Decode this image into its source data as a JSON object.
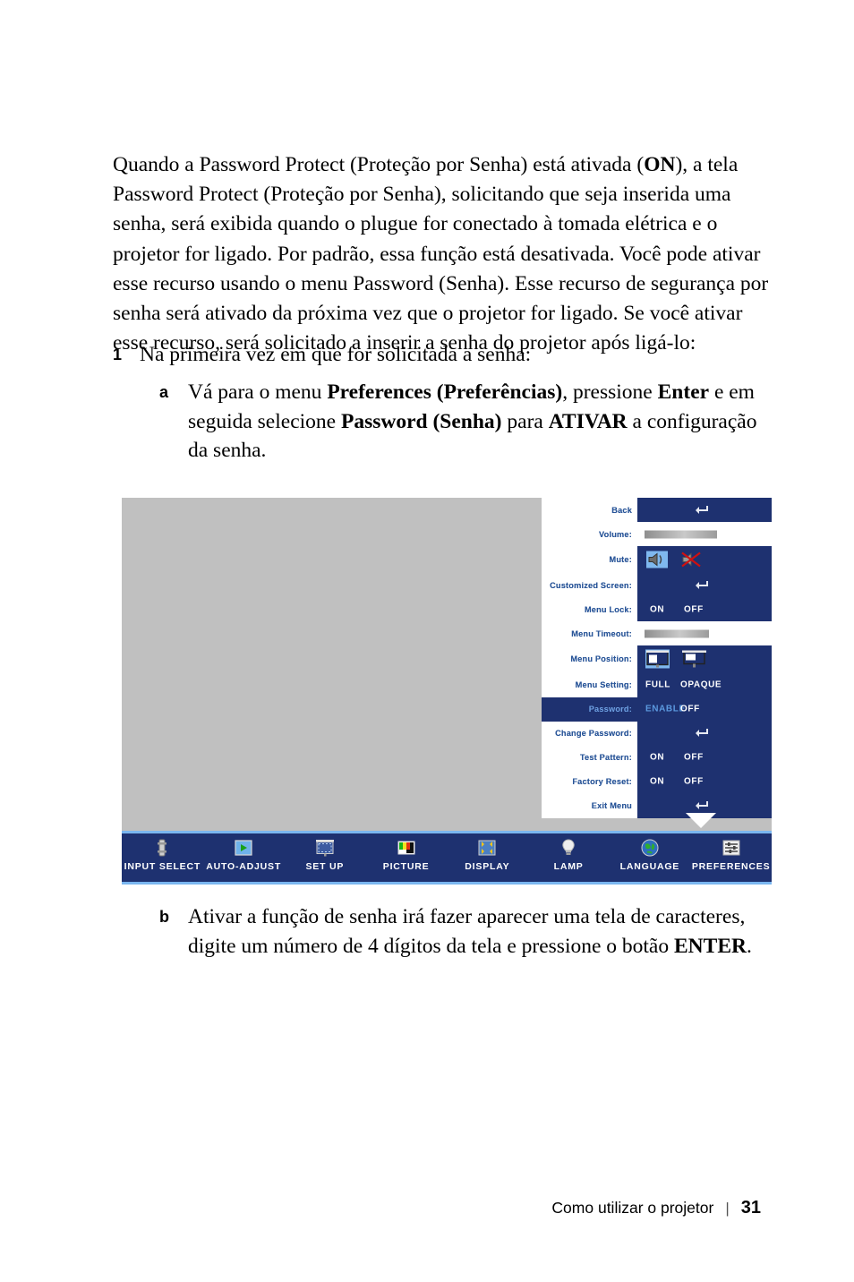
{
  "document": {
    "intro_paragraph": "Quando a Password Protect (Proteção por Senha) está ativada (ON), a tela Password Protect (Proteção por Senha), solicitando que seja inserida uma senha, será exibida quando o plugue for conectado à tomada elétrica e o projetor for ligado. Por padrão, essa função está desativada. Você pode ativar esse recurso usando o menu Password (Senha). Esse recurso de segurança por senha será ativado da próxima vez que o projetor for ligado. Se você ativar esse recurso, será solicitado a inserir a senha do projetor após ligá-lo:",
    "step1": {
      "number": "1",
      "text": "Na primeira vez em que for solicitada a senha:"
    },
    "substep_a": {
      "letter": "a",
      "text": "Vá para o menu Preferences (Preferências), pressione Enter e em seguida selecione Password (Senha) para ATIVAR a configuração da senha."
    },
    "substep_b": {
      "letter": "b",
      "text": "Ativar a função de senha irá fazer aparecer uma tela de caracteres, digite um número de 4 dígitos da tela e pressione o botão ENTER."
    },
    "footer": {
      "chapter": "Como utilizar o projetor",
      "divider": "|",
      "page_number": "31"
    }
  },
  "osd": {
    "background_color": "#c0c0c0",
    "menu_color": "#1e3170",
    "label_color": "#2a5699",
    "highlight_color": "#5c9ae0",
    "accent_border": "#7ab6f0",
    "rows": [
      {
        "label": "Back",
        "type": "return",
        "value": "return-arrow"
      },
      {
        "label": "Volume:",
        "type": "slider",
        "value": "62"
      },
      {
        "label": "Mute:",
        "type": "icons",
        "options": [
          "speaker-on-icon",
          "speaker-mute-icon"
        ],
        "selected": 0
      },
      {
        "label": "Customized Screen:",
        "type": "return",
        "value": "return-arrow"
      },
      {
        "label": "Menu Lock:",
        "type": "options",
        "options": [
          "ON",
          "OFF"
        ],
        "selected": 1
      },
      {
        "label": "Menu Timeout:",
        "type": "slider",
        "value": "55"
      },
      {
        "label": "Menu Position:",
        "type": "icons",
        "options": [
          "menu-position-left-icon",
          "menu-position-top-icon"
        ],
        "selected": 0
      },
      {
        "label": "Menu Setting:",
        "type": "options",
        "options": [
          "FULL",
          "OPAQUE"
        ],
        "selected": 0
      },
      {
        "label": "Password:",
        "type": "options",
        "options": [
          "ENABLE",
          "OFF"
        ],
        "selected": 0,
        "highlighted": true
      },
      {
        "label": "Change Password:",
        "type": "return",
        "value": "return-arrow"
      },
      {
        "label": "Test Pattern:",
        "type": "options",
        "options": [
          "ON",
          "OFF"
        ],
        "selected": 1
      },
      {
        "label": "Factory Reset:",
        "type": "options",
        "options": [
          "ON",
          "OFF"
        ],
        "selected": 1
      },
      {
        "label": "Exit Menu",
        "type": "return",
        "value": "return-arrow"
      }
    ],
    "toolbar": [
      {
        "label": "INPUT SELECT",
        "icon": "input-select-icon"
      },
      {
        "label": "AUTO-ADJUST",
        "icon": "auto-adjust-icon"
      },
      {
        "label": "SET UP",
        "icon": "set-up-icon"
      },
      {
        "label": "PICTURE",
        "icon": "picture-icon"
      },
      {
        "label": "DISPLAY",
        "icon": "display-icon"
      },
      {
        "label": "LAMP",
        "icon": "lamp-icon"
      },
      {
        "label": "LANGUAGE",
        "icon": "language-icon"
      },
      {
        "label": "PREFERENCES",
        "icon": "preferences-icon",
        "active": true
      }
    ]
  }
}
